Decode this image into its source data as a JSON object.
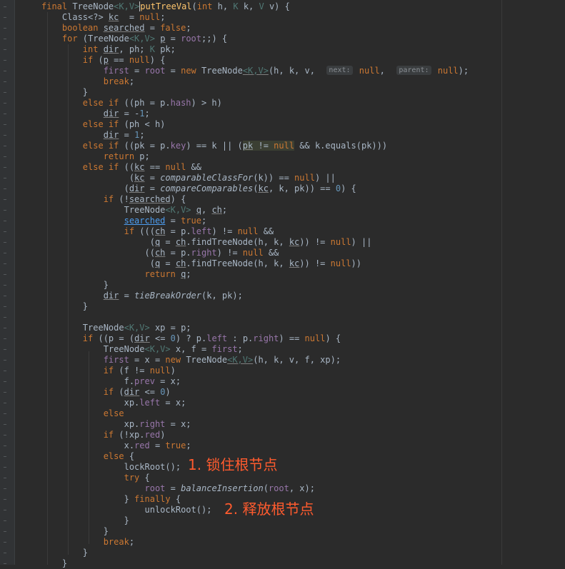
{
  "editor": {
    "lines": [
      [
        [
          "k",
          "final "
        ],
        [
          "",
          "TreeNode"
        ],
        [
          "tp",
          "<K,V>"
        ],
        [
          "",
          ""
        ],
        [
          "f cur",
          "putTreeVal"
        ],
        [
          "",
          "("
        ],
        [
          "k",
          "int "
        ],
        [
          "",
          "h, "
        ],
        [
          "tp",
          "K "
        ],
        [
          "",
          "k, "
        ],
        [
          "tp",
          "V "
        ],
        [
          "",
          "v) {"
        ]
      ],
      [
        [
          "",
          "    Class<?> "
        ],
        [
          "u",
          "kc"
        ],
        [
          "",
          ""
        ],
        [
          "",
          ""
        ],
        [
          "",
          ""
        ],
        [
          "",
          ""
        ],
        [
          "",
          ""
        ],
        [
          "",
          ""
        ],
        [
          "",
          ""
        ],
        [
          "",
          ""
        ],
        [
          "",
          ""
        ],
        [
          "",
          ""
        ],
        [
          "",
          "  = "
        ],
        [
          "k",
          "null"
        ],
        [
          "",
          ";"
        ]
      ],
      [
        [
          "k",
          "    boolean "
        ],
        [
          "u",
          "searched"
        ],
        [
          "",
          ""
        ],
        [
          "",
          ""
        ],
        [
          "",
          ""
        ],
        [
          "",
          ""
        ],
        [
          "",
          ""
        ],
        [
          "",
          ""
        ],
        [
          "",
          ""
        ],
        [
          "",
          ""
        ],
        [
          "",
          ""
        ],
        [
          "",
          ""
        ],
        [
          "",
          ""
        ],
        [
          "",
          " = "
        ],
        [
          "k",
          "false"
        ],
        [
          "",
          ";"
        ]
      ],
      [
        [
          "k",
          "    for "
        ],
        [
          "",
          "(TreeNode"
        ],
        [
          "tp",
          "<K,V>"
        ],
        [
          "",
          ""
        ],
        [
          "",
          ""
        ],
        [
          "",
          ""
        ],
        [
          "",
          ""
        ],
        [
          "",
          ""
        ],
        [
          "",
          ""
        ],
        [
          "",
          ""
        ],
        [
          "",
          ""
        ],
        [
          "",
          ""
        ],
        [
          "",
          ""
        ],
        [
          "",
          " "
        ],
        [
          "u",
          "p"
        ],
        [
          "",
          " = "
        ],
        [
          "fd",
          "root"
        ],
        [
          "",
          ";;) {"
        ]
      ],
      [
        [
          "k",
          "        int "
        ],
        [
          "u",
          "dir"
        ],
        [
          "",
          ", ph; "
        ],
        [
          "tp",
          "K "
        ],
        [
          "",
          "pk;"
        ]
      ],
      [
        [
          "k",
          "        if "
        ],
        [
          "",
          "("
        ],
        [
          "u",
          "p"
        ],
        [
          "",
          " == "
        ],
        [
          "k",
          "null"
        ],
        [
          "",
          ") {"
        ]
      ],
      [
        [
          "",
          "            "
        ],
        [
          "fd",
          "first"
        ],
        [
          "",
          " = "
        ],
        [
          "fd",
          "root"
        ],
        [
          "",
          " = "
        ],
        [
          "k",
          "new "
        ],
        [
          "",
          "TreeNode"
        ],
        [
          "tp u",
          "<K,V>"
        ],
        [
          "",
          "(h, k, v,  "
        ],
        [
          "hint",
          "next:"
        ],
        [
          "",
          " "
        ],
        [
          "k",
          "null"
        ],
        [
          "",
          ",  "
        ],
        [
          "hint",
          "parent:"
        ],
        [
          "",
          " "
        ],
        [
          "k",
          "null"
        ],
        [
          "",
          ");"
        ]
      ],
      [
        [
          "k",
          "            break"
        ],
        [
          "",
          ";"
        ]
      ],
      [
        [
          "",
          "        }"
        ]
      ],
      [
        [
          "k",
          "        else if "
        ],
        [
          "",
          "((ph = p."
        ],
        [
          "fd",
          "hash"
        ],
        [
          "",
          ") > h)"
        ]
      ],
      [
        [
          "",
          "            "
        ],
        [
          "u",
          "dir"
        ],
        [
          "",
          " = -"
        ],
        [
          "nm",
          "1"
        ],
        [
          "",
          ";"
        ]
      ],
      [
        [
          "k",
          "        else if "
        ],
        [
          "",
          "(ph < h)"
        ]
      ],
      [
        [
          "",
          "            "
        ],
        [
          "u",
          "dir"
        ],
        [
          "",
          " = "
        ],
        [
          "nm",
          "1"
        ],
        [
          "",
          ";"
        ]
      ],
      [
        [
          "k",
          "        else if "
        ],
        [
          "",
          "((pk = p."
        ],
        [
          "fd",
          "key"
        ],
        [
          "",
          ") == k || ("
        ],
        [
          "hl u",
          "pk"
        ],
        [
          "hl",
          " != "
        ],
        [
          "hl k",
          "null"
        ],
        [
          "",
          " && k.equals(pk)))"
        ]
      ],
      [
        [
          "k",
          "            return "
        ],
        [
          "",
          "p;"
        ]
      ],
      [
        [
          "k",
          "        else if "
        ],
        [
          "",
          "(("
        ],
        [
          "u",
          "kc"
        ],
        [
          "",
          " == "
        ],
        [
          "k",
          "null "
        ],
        [
          "",
          "&&"
        ]
      ],
      [
        [
          "",
          "                 ("
        ],
        [
          "u",
          "kc"
        ],
        [
          "",
          " = "
        ],
        [
          "it",
          "comparableClassFor"
        ],
        [
          "",
          "(k)) == "
        ],
        [
          "k",
          "null"
        ],
        [
          "",
          ") ||"
        ]
      ],
      [
        [
          "",
          "                ("
        ],
        [
          "u",
          "dir"
        ],
        [
          "",
          " = "
        ],
        [
          "it",
          "compareComparables"
        ],
        [
          "",
          "("
        ],
        [
          "u",
          "kc"
        ],
        [
          "",
          ", k, pk)) == "
        ],
        [
          "nm",
          "0"
        ],
        [
          "",
          ") {"
        ]
      ],
      [
        [
          "k",
          "            if "
        ],
        [
          "",
          "(!"
        ],
        [
          "u",
          "searched"
        ],
        [
          "",
          ") {"
        ]
      ],
      [
        [
          "",
          "                TreeNode"
        ],
        [
          "tp",
          "<K,V>"
        ],
        [
          "",
          " "
        ],
        [
          "u",
          "q"
        ],
        [
          "",
          ", "
        ],
        [
          "u",
          "ch"
        ],
        [
          "",
          ";"
        ]
      ],
      [
        [
          "",
          "                "
        ],
        [
          "ub",
          "searched"
        ],
        [
          "",
          " = "
        ],
        [
          "k",
          "true"
        ],
        [
          "",
          ";"
        ]
      ],
      [
        [
          "k",
          "                if "
        ],
        [
          "",
          "((("
        ],
        [
          "u",
          "ch"
        ],
        [
          "",
          " = p."
        ],
        [
          "fd",
          "left"
        ],
        [
          "",
          ") != "
        ],
        [
          "k",
          "null "
        ],
        [
          "",
          "&&"
        ]
      ],
      [
        [
          "",
          "                     ("
        ],
        [
          "u",
          "q"
        ],
        [
          "",
          " = "
        ],
        [
          "u",
          "ch"
        ],
        [
          "",
          ".findTreeNode(h, k, "
        ],
        [
          "u",
          "kc"
        ],
        [
          "",
          ")) != "
        ],
        [
          "k",
          "null"
        ],
        [
          "",
          ") ||"
        ]
      ],
      [
        [
          "",
          "                    (("
        ],
        [
          "u",
          "ch"
        ],
        [
          "",
          " = p."
        ],
        [
          "fd",
          "right"
        ],
        [
          "",
          ") != "
        ],
        [
          "k",
          "null "
        ],
        [
          "",
          "&&"
        ]
      ],
      [
        [
          "",
          "                     ("
        ],
        [
          "u",
          "q"
        ],
        [
          "",
          " = "
        ],
        [
          "u",
          "ch"
        ],
        [
          "",
          ".findTreeNode(h, k, "
        ],
        [
          "u",
          "kc"
        ],
        [
          "",
          ")) != "
        ],
        [
          "k",
          "null"
        ],
        [
          "",
          "))"
        ]
      ],
      [
        [
          "k",
          "                    return "
        ],
        [
          "u",
          "q"
        ],
        [
          "",
          ";"
        ]
      ],
      [
        [
          "",
          "            }"
        ]
      ],
      [
        [
          "",
          "            "
        ],
        [
          "u",
          "dir"
        ],
        [
          "",
          " = "
        ],
        [
          "it",
          "tieBreakOrder"
        ],
        [
          "",
          "(k, pk);"
        ]
      ],
      [
        [
          "",
          "        }"
        ]
      ],
      [
        [
          "",
          ""
        ]
      ],
      [
        [
          "",
          "        TreeNode"
        ],
        [
          "tp",
          "<K,V>"
        ],
        [
          "",
          " xp = p;"
        ]
      ],
      [
        [
          "k",
          "        if "
        ],
        [
          "",
          "((p = ("
        ],
        [
          "u",
          "dir"
        ],
        [
          "",
          " <= "
        ],
        [
          "nm",
          "0"
        ],
        [
          "",
          ") ? p."
        ],
        [
          "fd",
          "left "
        ],
        [
          "",
          ": p."
        ],
        [
          "fd",
          "right"
        ],
        [
          "",
          ") == "
        ],
        [
          "k",
          "null"
        ],
        [
          "",
          ") {"
        ]
      ],
      [
        [
          "",
          "            TreeNode"
        ],
        [
          "tp",
          "<K,V>"
        ],
        [
          "",
          " x, f = "
        ],
        [
          "fd",
          "first"
        ],
        [
          "",
          ";"
        ]
      ],
      [
        [
          "",
          "            "
        ],
        [
          "fd",
          "first"
        ],
        [
          "",
          " = x = "
        ],
        [
          "k",
          "new "
        ],
        [
          "",
          "TreeNode"
        ],
        [
          "tp u",
          "<K,V>"
        ],
        [
          "",
          "(h, k, v, f, xp);"
        ]
      ],
      [
        [
          "k",
          "            if "
        ],
        [
          "",
          "(f != "
        ],
        [
          "k",
          "null"
        ],
        [
          "",
          ")"
        ]
      ],
      [
        [
          "",
          "                f."
        ],
        [
          "fd",
          "prev"
        ],
        [
          "",
          " = x;"
        ]
      ],
      [
        [
          "k",
          "            if "
        ],
        [
          "",
          "("
        ],
        [
          "u",
          "dir"
        ],
        [
          "",
          " <= "
        ],
        [
          "nm",
          "0"
        ],
        [
          "",
          ")"
        ]
      ],
      [
        [
          "",
          "                xp."
        ],
        [
          "fd",
          "left"
        ],
        [
          "",
          " = x;"
        ]
      ],
      [
        [
          "k",
          "            else"
        ]
      ],
      [
        [
          "",
          "                xp."
        ],
        [
          "fd",
          "right"
        ],
        [
          "",
          " = x;"
        ]
      ],
      [
        [
          "k",
          "            if "
        ],
        [
          "",
          "(!xp."
        ],
        [
          "fd",
          "red"
        ],
        [
          "",
          ")"
        ]
      ],
      [
        [
          "",
          "                x."
        ],
        [
          "fd",
          "red"
        ],
        [
          "",
          " = "
        ],
        [
          "k",
          "true"
        ],
        [
          "",
          ";"
        ]
      ],
      [
        [
          "k",
          "            else "
        ],
        [
          "",
          "{"
        ]
      ],
      [
        [
          "",
          "                lockRoot();"
        ]
      ],
      [
        [
          "k",
          "                try "
        ],
        [
          "",
          "{"
        ]
      ],
      [
        [
          "",
          "                    "
        ],
        [
          "fd",
          "root"
        ],
        [
          "",
          " = "
        ],
        [
          "it",
          "balanceInsertion"
        ],
        [
          "",
          "("
        ],
        [
          "fd",
          "root"
        ],
        [
          "",
          ", x);"
        ]
      ],
      [
        [
          "",
          "                } "
        ],
        [
          "k",
          "finally "
        ],
        [
          "",
          "{"
        ]
      ],
      [
        [
          "",
          "                    unlockRoot();"
        ]
      ],
      [
        [
          "",
          "                }"
        ]
      ],
      [
        [
          "",
          "            }"
        ]
      ],
      [
        [
          "k",
          "            break"
        ],
        [
          "",
          ";"
        ]
      ],
      [
        [
          "",
          "        }"
        ]
      ],
      [
        [
          "",
          "    }"
        ]
      ]
    ]
  },
  "annotations": {
    "lock_root": "1. 锁住根节点",
    "release_root": "2. 释放根节点"
  },
  "colors": {
    "background": "#2b2b2b",
    "keyword": "#cc7832",
    "method_declaration": "#ffc66d",
    "type_parameter": "#507874",
    "field": "#9876aa",
    "number": "#6897bb",
    "annotation": "#ff5b2e"
  }
}
